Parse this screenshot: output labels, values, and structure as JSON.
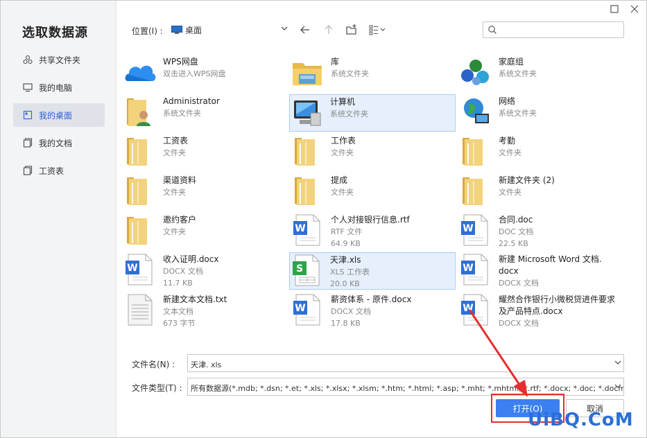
{
  "dialog": {
    "title": "选取数据源"
  },
  "sidebar": {
    "items": [
      {
        "label": "共享文件夹",
        "icon": "share-icon",
        "active": false
      },
      {
        "label": "我的电脑",
        "icon": "computer-icon",
        "active": false
      },
      {
        "label": "我的桌面",
        "icon": "desktop-icon",
        "active": true
      },
      {
        "label": "我的文档",
        "icon": "documents-icon",
        "active": false
      },
      {
        "label": "工资表",
        "icon": "folder-icon",
        "active": false
      }
    ]
  },
  "toolbar": {
    "location_label": "位置(I) :",
    "location_value": "桌面"
  },
  "files": [
    {
      "name": "WPS网盘",
      "sub1": "双击进入WPS网盘",
      "sub2": "",
      "type": "cloud"
    },
    {
      "name": "库",
      "sub1": "系统文件夹",
      "sub2": "",
      "type": "library"
    },
    {
      "name": "家庭组",
      "sub1": "系统文件夹",
      "sub2": "",
      "type": "homegroup"
    },
    {
      "name": "Administrator",
      "sub1": "系统文件夹",
      "sub2": "",
      "type": "user"
    },
    {
      "name": "计算机",
      "sub1": "系统文件夹",
      "sub2": "",
      "type": "computer"
    },
    {
      "name": "网络",
      "sub1": "系统文件夹",
      "sub2": "",
      "type": "network"
    },
    {
      "name": "工资表",
      "sub1": "文件夹",
      "sub2": "",
      "type": "folder"
    },
    {
      "name": "工作表",
      "sub1": "文件夹",
      "sub2": "",
      "type": "folder"
    },
    {
      "name": "考勤",
      "sub1": "文件夹",
      "sub2": "",
      "type": "folder"
    },
    {
      "name": "渠道资料",
      "sub1": "文件夹",
      "sub2": "",
      "type": "folder"
    },
    {
      "name": "提成",
      "sub1": "文件夹",
      "sub2": "",
      "type": "folder"
    },
    {
      "name": "新建文件夹 (2)",
      "sub1": "文件夹",
      "sub2": "",
      "type": "folder"
    },
    {
      "name": "邀约客户",
      "sub1": "文件夹",
      "sub2": "",
      "type": "folder"
    },
    {
      "name": "个人对接银行信息.rtf",
      "sub1": "RTF 文件",
      "sub2": "64.9 KB",
      "type": "doc"
    },
    {
      "name": "合同.doc",
      "sub1": "DOC 文档",
      "sub2": "22.5 KB",
      "type": "doc"
    },
    {
      "name": "收入证明.docx",
      "sub1": "DOCX 文档",
      "sub2": "11.7 KB",
      "type": "doc"
    },
    {
      "name": "天津.xls",
      "sub1": "XLS 工作表",
      "sub2": "20.0 KB",
      "type": "xls"
    },
    {
      "name": "新建 Microsoft Word 文档.",
      "name2": "docx",
      "sub1": "DOCX 文档",
      "sub2": "",
      "type": "doc"
    },
    {
      "name": "新建文本文档.txt",
      "sub1": "文本文档",
      "sub2": "673 字节",
      "type": "txt"
    },
    {
      "name": "薪资体系 - 原件.docx",
      "sub1": "DOCX 文档",
      "sub2": "17.8 KB",
      "type": "doc"
    },
    {
      "name": "耀然合作银行小微税贷进件要求",
      "name2": "及产品特点.docx",
      "sub1": "DOCX 文档",
      "sub2": "",
      "type": "doc"
    }
  ],
  "form": {
    "filename_label": "文件名(N) :",
    "filename_value": "天津. xls",
    "filetype_label": "文件类型(T) :",
    "filetype_value": "所有数据源(*.mdb; *.dsn; *.et; *.xls; *.xlsx; *.xlsm; *.htm; *.html; *.asp; *.mht; *.mhtml; *.rtf; *.docx; *.doc; *.docm; *."
  },
  "buttons": {
    "open": "打开(O)",
    "cancel": "取消"
  },
  "watermark": "UiBQ.CoM",
  "colors": {
    "accent": "#3b7ff0",
    "highlight": "#e52d2d",
    "selected_bg": "#e5f0fc"
  }
}
